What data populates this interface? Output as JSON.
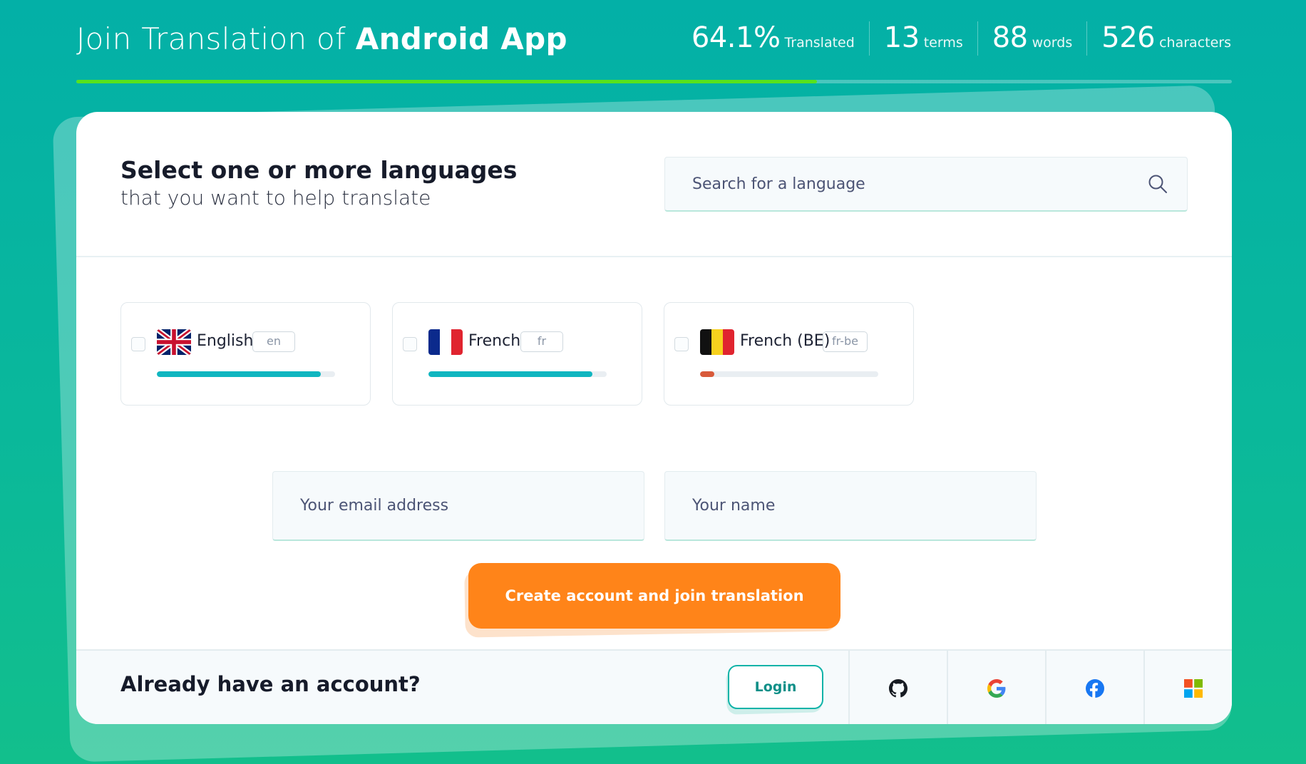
{
  "header": {
    "title_prefix": "Join Translation of",
    "project_name": "Android App",
    "progress_fraction": 0.641,
    "stats": [
      {
        "value": "64.1%",
        "label": "Translated"
      },
      {
        "value": "13",
        "label": "terms"
      },
      {
        "value": "88",
        "label": "words"
      },
      {
        "value": "526",
        "label": "characters"
      }
    ]
  },
  "languages_section": {
    "heading": "Select one or more languages",
    "subheading": "that you want to help translate",
    "search_placeholder": "Search for a language",
    "search_icon": "search-icon"
  },
  "languages": [
    {
      "name": "English",
      "code": "en",
      "flag": "uk-flag-icon",
      "progress": 0.92,
      "bar_color": "#10b6c0",
      "checked": false
    },
    {
      "name": "French",
      "code": "fr",
      "flag": "france-flag-icon",
      "progress": 0.92,
      "bar_color": "#10b6c0",
      "checked": false
    },
    {
      "name": "French (BE)",
      "code": "fr-be",
      "flag": "belgium-flag-icon",
      "progress": 0.08,
      "bar_color": "#d85a3a",
      "checked": false
    }
  ],
  "form": {
    "email_placeholder": "Your email address",
    "name_placeholder": "Your name",
    "submit_label": "Create account and join translation"
  },
  "footer": {
    "account_text": "Already have an account?",
    "login_label": "Login",
    "social_icons": [
      "github-icon",
      "google-icon",
      "facebook-icon",
      "microsoft-icon"
    ]
  },
  "colors": {
    "accent": "#10b3a8",
    "progress_green": "#57e31d",
    "cta_orange": "#ff8419"
  }
}
